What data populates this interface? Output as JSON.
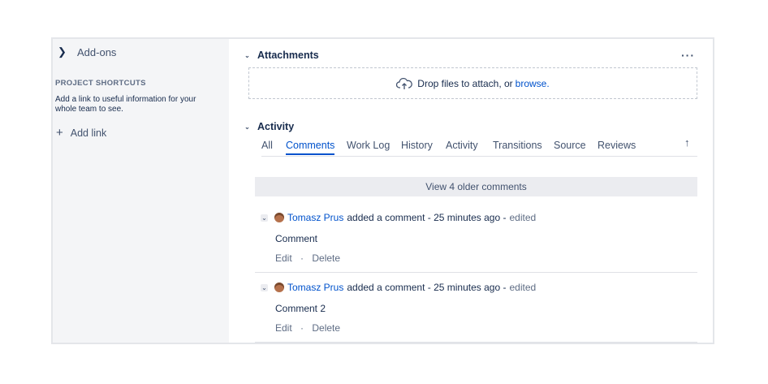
{
  "sidebar": {
    "addons_label": "Add-ons",
    "shortcuts_title": "PROJECT SHORTCUTS",
    "shortcuts_desc": "Add a link to useful information for your whole team to see.",
    "add_link_label": "Add link"
  },
  "attachments": {
    "title": "Attachments",
    "more_label": "···",
    "drop_text": "Drop files to attach, or ",
    "browse_label": "browse."
  },
  "activity": {
    "title": "Activity",
    "tabs": [
      "All",
      "Comments",
      "Work Log",
      "History",
      "Activity",
      "Transitions",
      "Source",
      "Reviews"
    ],
    "active_tab": "Comments",
    "sort_icon": "↑",
    "older_label": "View 4 older comments",
    "comments": [
      {
        "author": "Tomasz Prus",
        "action": "added a comment - 25 minutes ago -",
        "edited": "edited",
        "body": "Comment",
        "edit": "Edit",
        "sep": "·",
        "delete": "Delete"
      },
      {
        "author": "Tomasz Prus",
        "action": "added a comment - 25 minutes ago -",
        "edited": "edited",
        "body": "Comment 2",
        "edit": "Edit",
        "sep": "·",
        "delete": "Delete"
      }
    ]
  },
  "colors": {
    "link": "#0052cc",
    "sidebar_bg": "#f4f5f7",
    "older_bg": "#ebecf0"
  }
}
